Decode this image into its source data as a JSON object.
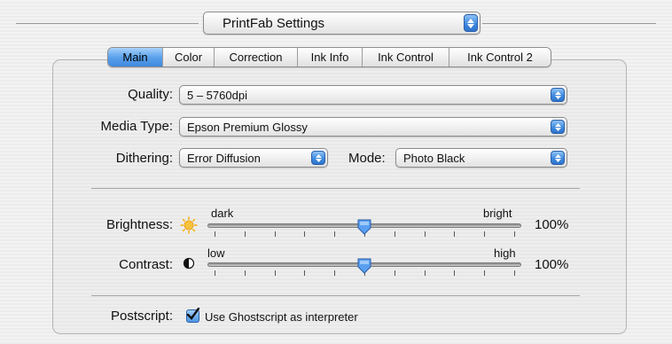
{
  "header": {
    "settings_popup": "PrintFab Settings"
  },
  "tabs": [
    {
      "label": "Main",
      "active": true
    },
    {
      "label": "Color"
    },
    {
      "label": "Correction"
    },
    {
      "label": "Ink Info"
    },
    {
      "label": "Ink Control"
    },
    {
      "label": "Ink Control 2"
    }
  ],
  "main": {
    "quality": {
      "label": "Quality:",
      "value": "5 – 5760dpi"
    },
    "media_type": {
      "label": "Media Type:",
      "value": "Epson Premium Glossy"
    },
    "dithering": {
      "label": "Dithering:",
      "value": "Error Diffusion"
    },
    "mode": {
      "label": "Mode:",
      "value": "Photo Black"
    },
    "brightness": {
      "label": "Brightness:",
      "min_label": "dark",
      "max_label": "bright",
      "value": "100%",
      "level": 0.5
    },
    "contrast": {
      "label": "Contrast:",
      "min_label": "low",
      "max_label": "high",
      "value": "100%",
      "level": 0.5
    },
    "postscript": {
      "label": "Postscript:",
      "checkbox_label": "Use Ghostscript as interpreter",
      "checked": true
    }
  },
  "colors": {
    "accent": "#3f87dd",
    "sun_icon": "#f6b21a"
  },
  "icons": {
    "brightness": "sun-icon",
    "contrast": "half-moon-icon",
    "popup": "up-down-arrows-icon",
    "thumb": "slider-thumb-icon"
  }
}
